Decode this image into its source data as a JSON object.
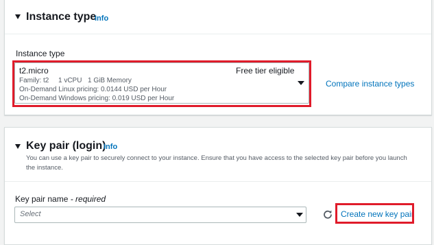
{
  "instance_type_section": {
    "title": "Instance type",
    "info": "Info",
    "field_label": "Instance type",
    "selected": {
      "name": "t2.micro",
      "badge": "Free tier eligible",
      "family": "Family: t2",
      "vcpu": "1 vCPU",
      "memory": "1 GiB Memory",
      "linux_pricing": "On-Demand Linux pricing: 0.0144 USD per Hour",
      "windows_pricing": "On-Demand Windows pricing: 0.019 USD per Hour"
    },
    "compare_link": "Compare instance types"
  },
  "key_pair_section": {
    "title": "Key pair (login)",
    "info": "Info",
    "description_line1": "You can use a key pair to securely connect to your instance. Ensure that you have access to the selected key pair before you launch",
    "description_line2": "the instance.",
    "field_label": "Key pair name",
    "field_label_suffix": " - required",
    "select_placeholder": "Select",
    "create_link": "Create new key pair"
  },
  "colors": {
    "link": "#0073bb",
    "highlight": "#e01b2a",
    "text": "#16191f",
    "muted": "#545b64"
  },
  "icons": {
    "collapse": "caret-down-icon",
    "dropdown": "dropdown-arrow-icon",
    "refresh": "refresh-icon"
  }
}
